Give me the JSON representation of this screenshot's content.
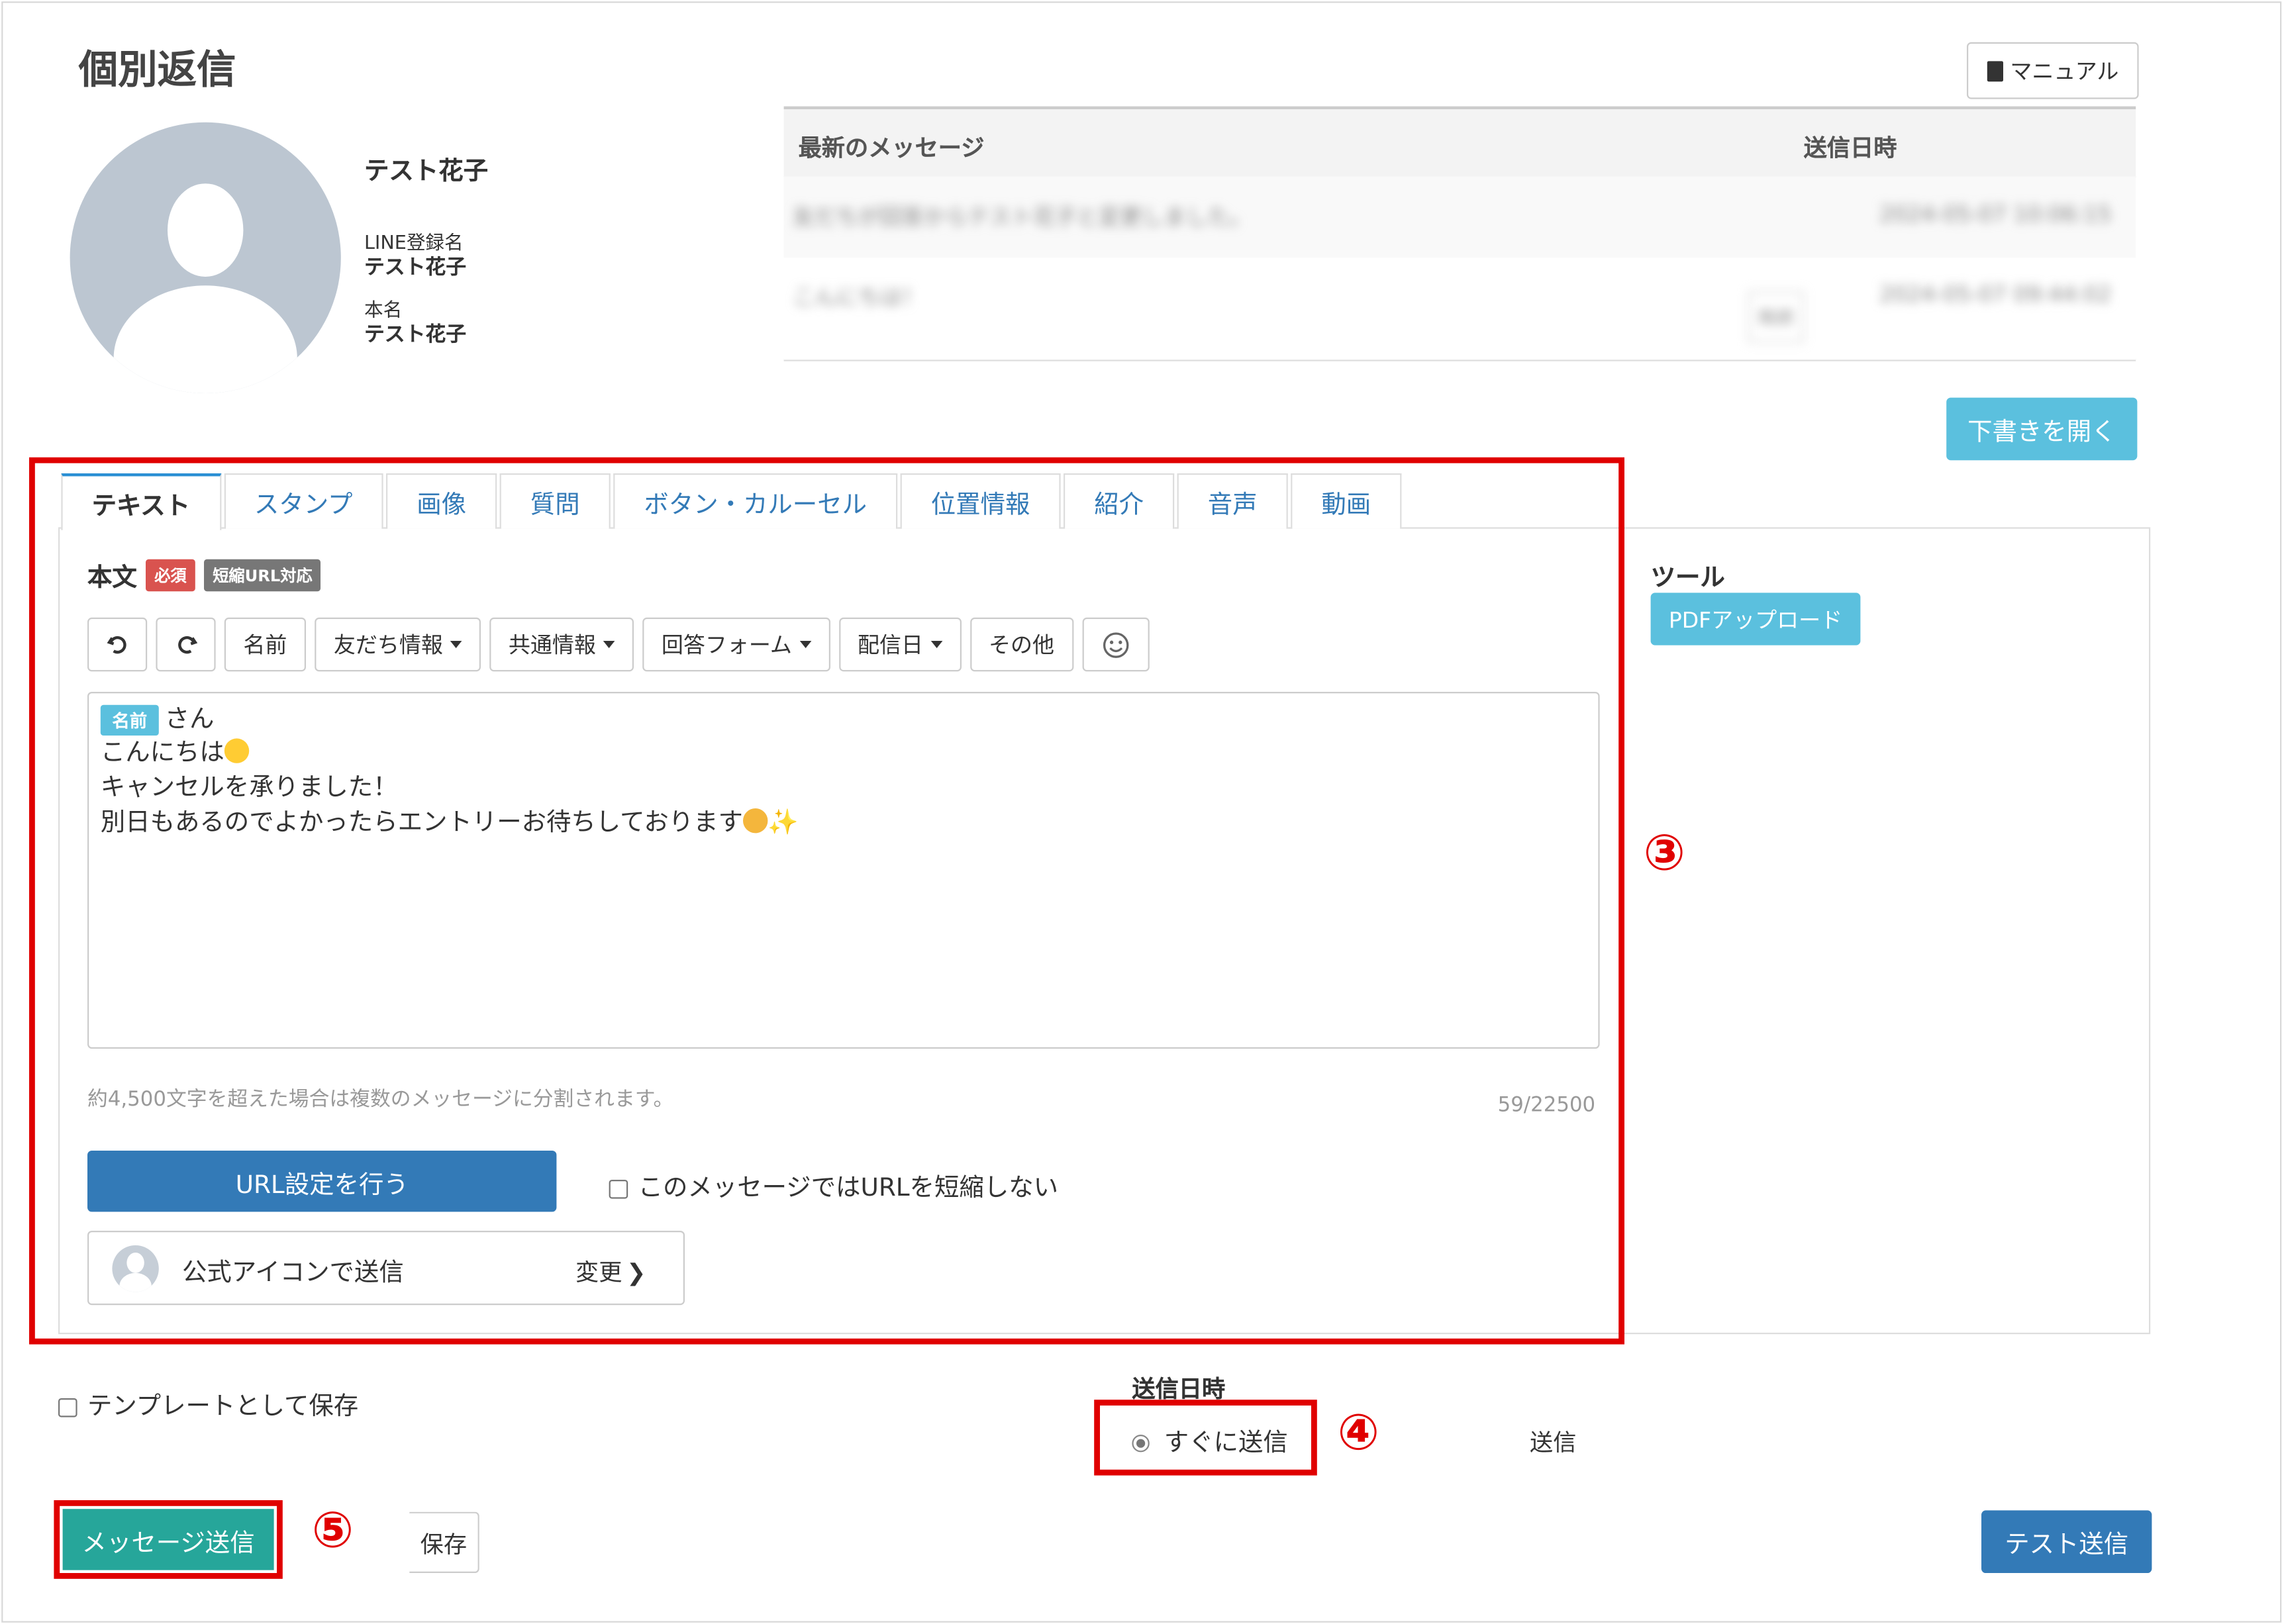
{
  "page": {
    "title": "個別返信",
    "manual_label": "マニュアル",
    "draft_label": "下書きを開く"
  },
  "profile": {
    "display_name": "テスト花子",
    "line_name_label": "LINE登録名",
    "line_name": "テスト花子",
    "real_name_label": "本名",
    "real_name": "テスト花子"
  },
  "recent_messages": {
    "col_message": "最新のメッセージ",
    "col_datetime": "送信日時",
    "rows": [
      {
        "message": "友だちが回答からテスト花子と変更しました。",
        "datetime": "2024-05-07 10:06:15",
        "badge": ""
      },
      {
        "message": "こんにちは！",
        "datetime": "2024-05-07 09:44:02",
        "badge": "既読"
      }
    ]
  },
  "tabs": [
    {
      "label": "テキスト"
    },
    {
      "label": "スタンプ"
    },
    {
      "label": "画像"
    },
    {
      "label": "質問"
    },
    {
      "label": "ボタン・カルーセル"
    },
    {
      "label": "位置情報"
    },
    {
      "label": "紹介"
    },
    {
      "label": "音声"
    },
    {
      "label": "動画"
    }
  ],
  "editor": {
    "body_label": "本文",
    "required_badge": "必須",
    "short_url_badge": "短縮URL対応",
    "toolbar": {
      "undo_icon": "undo-icon",
      "redo_icon": "redo-icon",
      "name": "名前",
      "friend_info": "友だち情報",
      "common_info": "共通情報",
      "answer_form": "回答フォーム",
      "delivery_date": "配信日",
      "other": "その他",
      "emoji_icon": "smile-icon"
    },
    "name_chip": "名前",
    "line1_suffix": "さん",
    "line2": "こんにちは",
    "line3": "キャンセルを承りました！",
    "line4": "別日もあるのでよかったらエントリーお待ちしております",
    "split_note": "約4,500文字を超えた場合は複数のメッセージに分割されます。",
    "counter": "59/22500",
    "url_button": "URL設定を行う",
    "no_shorten_label": "このメッセージではURLを短縮しない",
    "icon_send_label": "公式アイコンで送信",
    "change_label": "変更"
  },
  "tools": {
    "title": "ツール",
    "pdf_upload": "PDFアップロード"
  },
  "footer": {
    "save_template_label": "テンプレートとして保存",
    "send_datetime_label": "送信日時",
    "send_now_label": "すぐに送信",
    "send_partial": "送信",
    "send_button": "メッセージ送信",
    "save_button": "保存",
    "test_send_button": "テスト送信"
  },
  "annotations": {
    "step3": "③",
    "step4": "④",
    "step5": "⑤"
  },
  "colors": {
    "highlight": "#e00000",
    "primary": "#337ab7",
    "info": "#5bc0de",
    "success": "#26a69a"
  }
}
